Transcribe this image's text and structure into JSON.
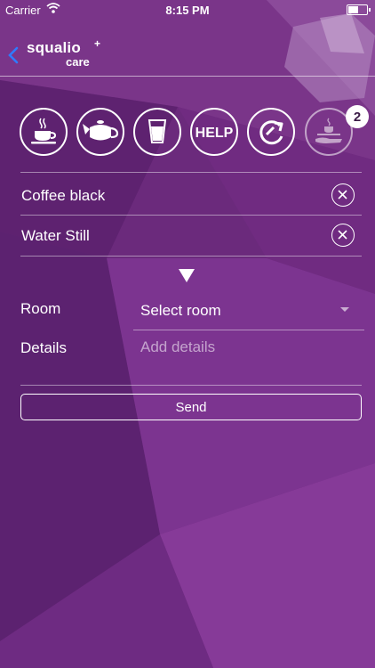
{
  "status_bar": {
    "carrier": "Carrier",
    "time": "8:15 PM"
  },
  "header": {
    "logo_name": "squalio",
    "logo_sub": "care",
    "logo_mark": "+"
  },
  "quick_actions": [
    {
      "name": "coffee",
      "icon": "coffee-cup-icon"
    },
    {
      "name": "tea",
      "icon": "teapot-icon"
    },
    {
      "name": "water",
      "icon": "glass-icon"
    },
    {
      "name": "help",
      "icon": "help-icon",
      "label": "HELP"
    },
    {
      "name": "refresh",
      "icon": "refresh-icon"
    },
    {
      "name": "order-tray",
      "icon": "serving-tray-icon",
      "badge": "2"
    }
  ],
  "order_items": [
    {
      "label": "Coffee black"
    },
    {
      "label": "Water Still"
    }
  ],
  "form": {
    "room_label": "Room",
    "room_value": "Select room",
    "details_label": "Details",
    "details_placeholder": "Add details",
    "details_value": ""
  },
  "send_label": "Send",
  "colors": {
    "background": "#6d2a7e",
    "accent": "#ffffff",
    "back_arrow": "#2f7bff"
  }
}
